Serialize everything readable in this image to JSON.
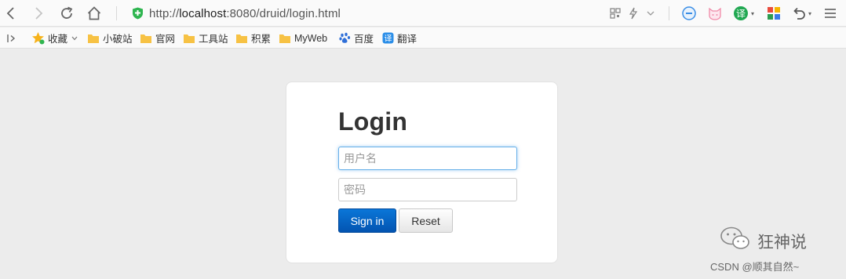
{
  "browser": {
    "url_prefix": "http://",
    "url_host": "localhost",
    "url_rest": ":8080/druid/login.html",
    "icons": {
      "back": "back-arrow-icon",
      "forward": "forward-arrow-icon",
      "reload": "reload-icon",
      "home": "home-icon",
      "security": "shield-icon",
      "qr": "qr-code-icon",
      "flash": "lightning-icon",
      "minus": "minus-circle-icon",
      "cat": "cat-icon",
      "translate": "translate-icon",
      "apps": "apps-grid-icon",
      "undo": "undo-icon",
      "menu": "menu-icon"
    },
    "translate_glyph": "译"
  },
  "bookmarks": {
    "favorites_label": "收藏",
    "items": [
      {
        "label": "小破站",
        "icon": "folder-icon"
      },
      {
        "label": "官网",
        "icon": "folder-icon"
      },
      {
        "label": "工具站",
        "icon": "folder-icon"
      },
      {
        "label": "积累",
        "icon": "folder-icon"
      },
      {
        "label": "MyWeb",
        "icon": "folder-icon"
      },
      {
        "label": "百度",
        "icon": "baidu-paw-icon"
      },
      {
        "label": "翻译",
        "icon": "translate-icon"
      }
    ]
  },
  "login": {
    "title": "Login",
    "username_placeholder": "用户名",
    "password_placeholder": "密码",
    "signin_label": "Sign in",
    "reset_label": "Reset"
  },
  "watermark": {
    "main": "狂神说",
    "sub": "CSDN @顺其自然~"
  },
  "colors": {
    "page_bg": "#ececec",
    "primary": "#0566c8",
    "focus": "#66afe9",
    "folder": "#f7c244",
    "shield": "#2fb550",
    "translate_green": "#21a852"
  }
}
